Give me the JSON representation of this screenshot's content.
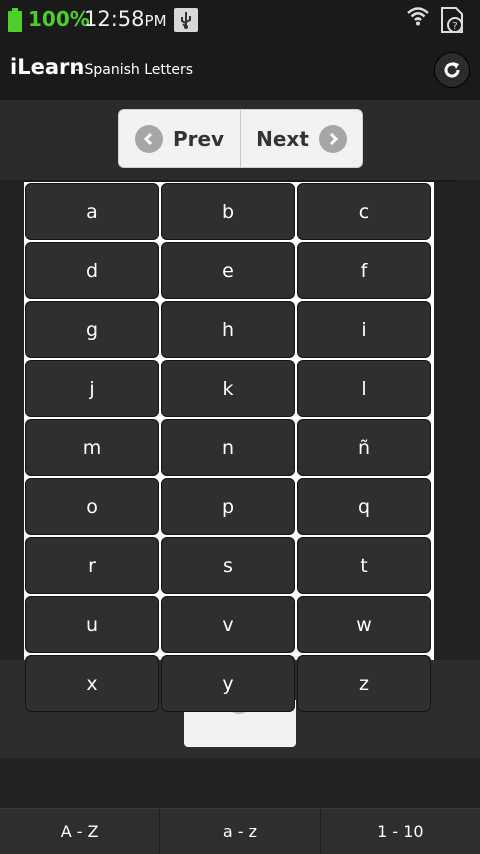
{
  "status_bar": {
    "battery_percent": "100%",
    "time": "12:58",
    "ampm": "PM",
    "icons": [
      "battery-icon",
      "usb-icon",
      "wifi-icon",
      "sim-icon"
    ],
    "battery_color": "#4fcf2a"
  },
  "header": {
    "title": "iLearn",
    "subtitle": "- Spanish Letters",
    "refresh_icon": "refresh-icon"
  },
  "nav": {
    "prev_label": "Prev",
    "next_label": "Next"
  },
  "letters": [
    "a",
    "b",
    "c",
    "d",
    "e",
    "f",
    "g",
    "h",
    "i",
    "j",
    "k",
    "l",
    "m",
    "n",
    "ñ",
    "o",
    "p",
    "q",
    "r",
    "s",
    "t",
    "u",
    "v",
    "w",
    "x",
    "y",
    "z"
  ],
  "tabs": [
    {
      "label": "A - Z"
    },
    {
      "label": "a - z"
    },
    {
      "label": "1 - 10"
    }
  ]
}
